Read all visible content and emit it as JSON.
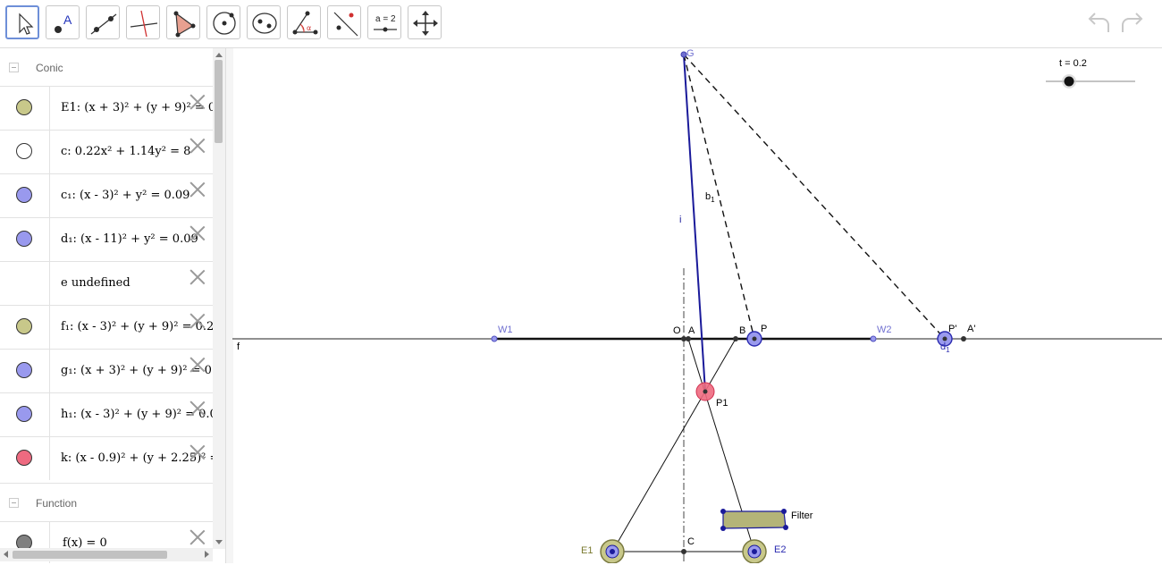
{
  "toolbar": {
    "tools": [
      "Move",
      "Point",
      "Line",
      "Perpendicular Line",
      "Polygon",
      "Circle with Center through Point",
      "Ellipse",
      "Angle",
      "Reflect about Line",
      "Slider",
      "Move Graphics View"
    ],
    "slider_tool_label": "a = 2"
  },
  "algebra": {
    "groups": [
      {
        "title": "Conic",
        "items": [
          {
            "color": "#c8c88a",
            "text": "E1: (x + 3)² + (y + 9)² = 0"
          },
          {
            "color": "#ffffff",
            "text": "c: 0.22x² + 1.14y² = 8"
          },
          {
            "color": "#9999ee",
            "text": "c₁: (x - 3)² + y² = 0.09"
          },
          {
            "color": "#9999ee",
            "text": "d₁: (x - 11)² + y² = 0.09"
          },
          {
            "color": "",
            "text": "e undefined"
          },
          {
            "color": "#c8c88a",
            "text": "f₁: (x - 3)² + (y + 9)² = 0.2"
          },
          {
            "color": "#9999ee",
            "text": "g₁: (x + 3)² + (y + 9)² = 0."
          },
          {
            "color": "#9999ee",
            "text": "h₁: (x - 3)² + (y + 9)² = 0.0"
          },
          {
            "color": "#ee6a80",
            "text": "k: (x - 0.9)² + (y + 2.25)² ="
          }
        ]
      },
      {
        "title": "Function",
        "items": [
          {
            "color": "#808080",
            "text": "f(x) = 0"
          }
        ]
      }
    ]
  },
  "graphics": {
    "slider_label": "t = 0.2",
    "slider_value": 0.2,
    "point_labels": {
      "G": "G",
      "i": "i",
      "b1": "b",
      "b1_sub": "1",
      "W1": "W1",
      "W2": "W2",
      "O": "O",
      "A": "A",
      "B": "B",
      "P": "P",
      "Pprime": "P'",
      "Aprime": "A'",
      "d1": "d",
      "d1_sub": "1",
      "f": "f",
      "P1": "P1",
      "C": "C",
      "E1": "E1",
      "E2": "E2",
      "Filter": "Filter"
    },
    "colors": {
      "blue_point": "#4040c0",
      "light_blue": "#9a9aee",
      "red_circle": "#ee6a80",
      "olive": "#b4b478",
      "line_blue": "#1a1a9a"
    }
  }
}
